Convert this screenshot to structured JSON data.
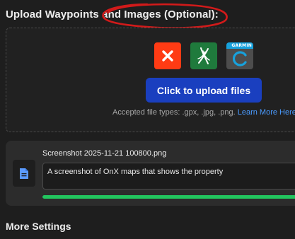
{
  "upload_section": {
    "title": "Upload Waypoints and Images (Optional):",
    "sources": [
      {
        "name": "clear-source",
        "icon": "x-icon",
        "color": "#ff3b14"
      },
      {
        "name": "onx",
        "icon": "onx-logo-icon",
        "color": "#1f7a3c"
      },
      {
        "name": "garmin",
        "icon": "garmin-logo-icon",
        "color": "#4d4d4d",
        "brand_text": "GARMIN"
      }
    ],
    "upload_button_label": "Click to upload files",
    "accepted_types_text": "Accepted file types: .gpx, .jpg, .png.",
    "learn_more_label": "Learn More Here"
  },
  "uploaded_file": {
    "file_name": "Screenshot 2025-11-21 100800.png",
    "description": "A screenshot of OnX maps that shows the property",
    "progress_percent": 100,
    "progress_color": "#22c55e"
  },
  "more_settings": {
    "title": "More Settings"
  },
  "annotation": {
    "color": "#d11a1a"
  }
}
